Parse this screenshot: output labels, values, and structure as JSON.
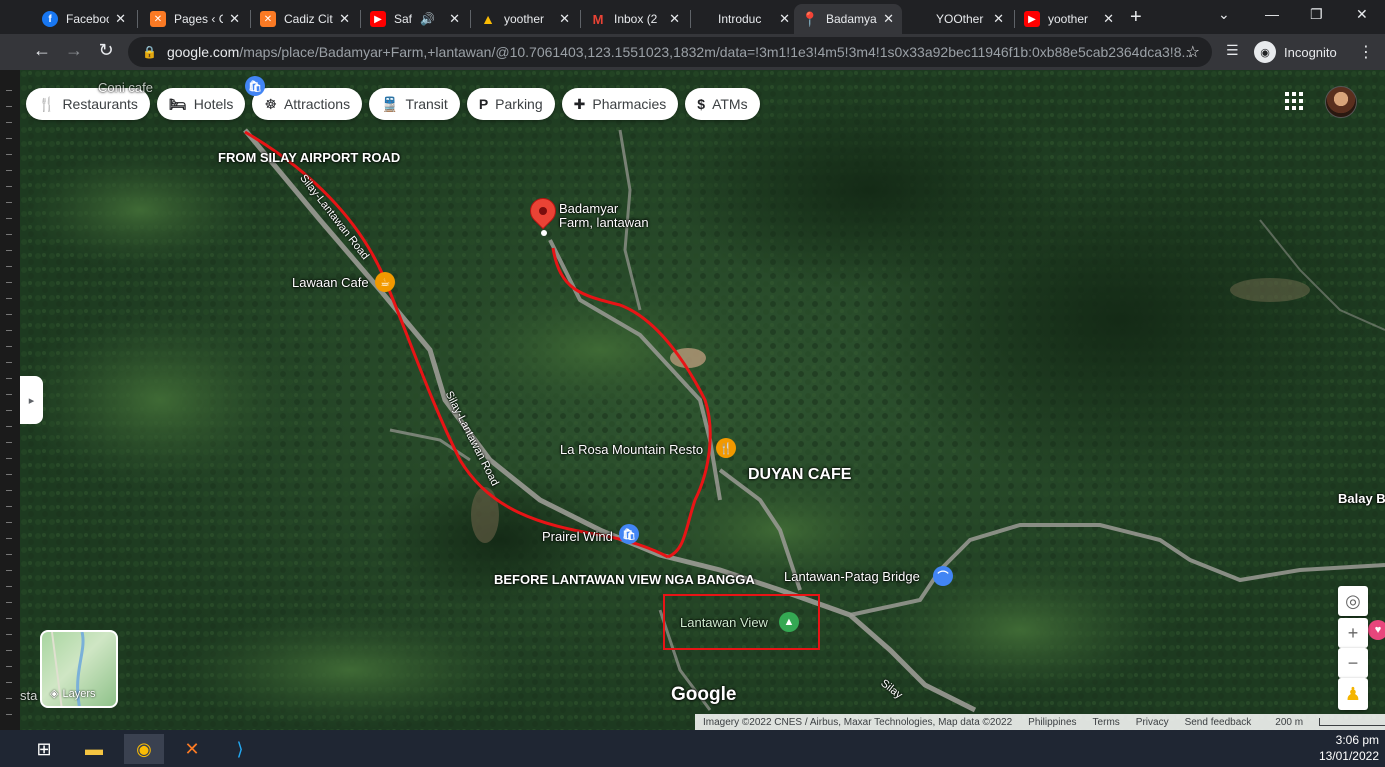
{
  "browser": {
    "tabs": [
      {
        "title": "Faceboo",
        "icon": "facebook-icon",
        "color": "#1877f2"
      },
      {
        "title": "Pages ‹ C",
        "icon": "xampp-icon",
        "color": "#fb7a24"
      },
      {
        "title": "Cadiz Cit",
        "icon": "xampp-icon",
        "color": "#fb7a24"
      },
      {
        "title": "Safe",
        "icon": "youtube-icon",
        "color": "#ff0000"
      },
      {
        "title": "yoother",
        "icon": "google-drive-icon",
        "color": "#34a853"
      },
      {
        "title": "Inbox (2",
        "icon": "gmail-icon",
        "color": "#ea4335"
      },
      {
        "title": "Introduc",
        "icon": "blank-page-icon",
        "color": "#202124"
      },
      {
        "title": "Badamya",
        "icon": "google-maps-icon",
        "color": "#34a853"
      },
      {
        "title": "YOOther",
        "icon": "blank-page-icon",
        "color": "#202124"
      },
      {
        "title": "yoother",
        "icon": "youtube-icon",
        "color": "#ff0000"
      }
    ],
    "url_host": "google.com",
    "url_path": "/maps/place/Badamyar+Farm,+lantawan/@10.7061403,123.1551023,1832m/data=!3m1!1e3!4m5!3m4!1s0x33a92bec11946f1b:0xb88e5cab2364dca3!8...",
    "incognito_label": "Incognito"
  },
  "map": {
    "chips": [
      {
        "label": "Restaurants",
        "icon": "fork-knife-icon",
        "glyph": "🍴"
      },
      {
        "label": "Hotels",
        "icon": "bed-icon",
        "glyph": "🛏"
      },
      {
        "label": "Attractions",
        "icon": "ferris-wheel-icon",
        "glyph": "☸"
      },
      {
        "label": "Transit",
        "icon": "train-icon",
        "glyph": "🚆"
      },
      {
        "label": "Parking",
        "icon": "parking-icon",
        "glyph": "P"
      },
      {
        "label": "Pharmacies",
        "icon": "pharmacy-icon",
        "glyph": "✚"
      },
      {
        "label": "ATMs",
        "icon": "atm-icon",
        "glyph": "$"
      }
    ],
    "places": {
      "badamyar_line1": "Badamyar",
      "badamyar_line2": "Farm, lantawan",
      "lawaan_cafe": "Lawaan Cafe",
      "la_rosa": "La Rosa Mountain Resto",
      "prairie_wind": "Prairel Wind",
      "lantawan_bridge": "Lantawan-Patag Bridge",
      "lantawan_view": "Lantawan View",
      "balay": "Balay B",
      "top_cut": "Coni cafe",
      "bottom_left_cut": "sta"
    },
    "roads": {
      "silay_lantawan_1": "Silay-Lantawan Road",
      "silay_lantawan_2": "Silay-Lantawan Road",
      "silay": "Silay"
    },
    "annotations": {
      "from_airport": "FROM SILAY AIRPORT ROAD",
      "duyan_cafe": "DUYAN CAFE",
      "before_lantawan": "BEFORE LANTAWAN VIEW NGA BANGGA"
    },
    "layers_label": "Layers",
    "google_logo": "Google",
    "attribution": {
      "imagery": "Imagery ©2022 CNES / Airbus, Maxar Technologies, Map data ©2022",
      "region": "Philippines",
      "terms": "Terms",
      "privacy": "Privacy",
      "feedback": "Send feedback",
      "scale": "200 m"
    }
  },
  "taskbar": {
    "time": "3:06 pm",
    "date": "13/01/2022"
  },
  "colors": {
    "route_red": "#e81416",
    "pin_red": "#ea4335",
    "poi_orange": "#f29900",
    "poi_blue": "#4285f4",
    "poi_green": "#34a853"
  }
}
